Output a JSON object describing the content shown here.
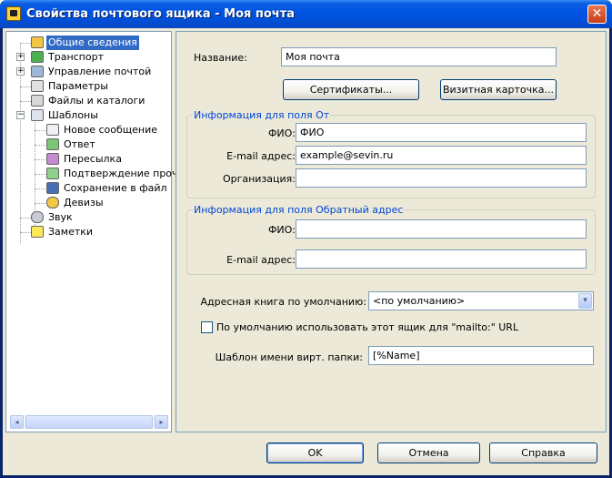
{
  "window": {
    "title": "Свойства почтового ящика - Моя почта",
    "close_glyph": "✕"
  },
  "tree": {
    "items": [
      {
        "label": "Общие сведения",
        "icon": "mailbox-icon",
        "selected": true
      },
      {
        "label": "Транспорт",
        "icon": "transport-icon"
      },
      {
        "label": "Управление почтой",
        "icon": "mail-management-icon"
      },
      {
        "label": "Параметры",
        "icon": "parameters-icon"
      },
      {
        "label": "Файлы и каталоги",
        "icon": "files-folders-icon"
      },
      {
        "label": "Шаблоны",
        "icon": "templates-icon"
      },
      {
        "label": "Новое сообщение",
        "icon": "new-message-icon"
      },
      {
        "label": "Ответ",
        "icon": "reply-icon"
      },
      {
        "label": "Пересылка",
        "icon": "forward-icon"
      },
      {
        "label": "Подтверждение прочт",
        "icon": "read-receipt-icon"
      },
      {
        "label": "Сохранение в файл",
        "icon": "save-to-file-icon"
      },
      {
        "label": "Девизы",
        "icon": "mottos-icon"
      },
      {
        "label": "Звук",
        "icon": "sound-icon"
      },
      {
        "label": "Заметки",
        "icon": "notes-icon"
      }
    ],
    "expander_plus": "+",
    "expander_minus": "−",
    "scroll_left": "◂",
    "scroll_right": "▸"
  },
  "general": {
    "name_label": "Название:",
    "name_value": "Моя почта",
    "certificates_button": "Сертификаты...",
    "business_card_button": "Визитная карточка...",
    "from_group_title": "Информация для поля От",
    "from_fio_label": "ФИО:",
    "from_fio_value": "ФИО",
    "from_email_label": "E-mail адрес:",
    "from_email_value": "example@sevin.ru",
    "from_org_label": "Организация:",
    "from_org_value": "",
    "reply_group_title": "Информация для поля Обратный адрес",
    "reply_fio_label": "ФИО:",
    "reply_fio_value": "",
    "reply_email_label": "E-mail адрес:",
    "reply_email_value": "",
    "addressbook_label": "Адресная книга по умолчанию:",
    "addressbook_value": "<по умолчанию>",
    "mailto_checkbox_label": "По умолчанию использовать этот ящик для \"mailto:\" URL",
    "mailto_checked": false,
    "folder_template_label": "Шаблон имени вирт. папки:",
    "folder_template_value": "[%Name]",
    "dropdown_glyph": "▾"
  },
  "footer": {
    "ok": "OK",
    "cancel": "Отмена",
    "help": "Справка"
  }
}
